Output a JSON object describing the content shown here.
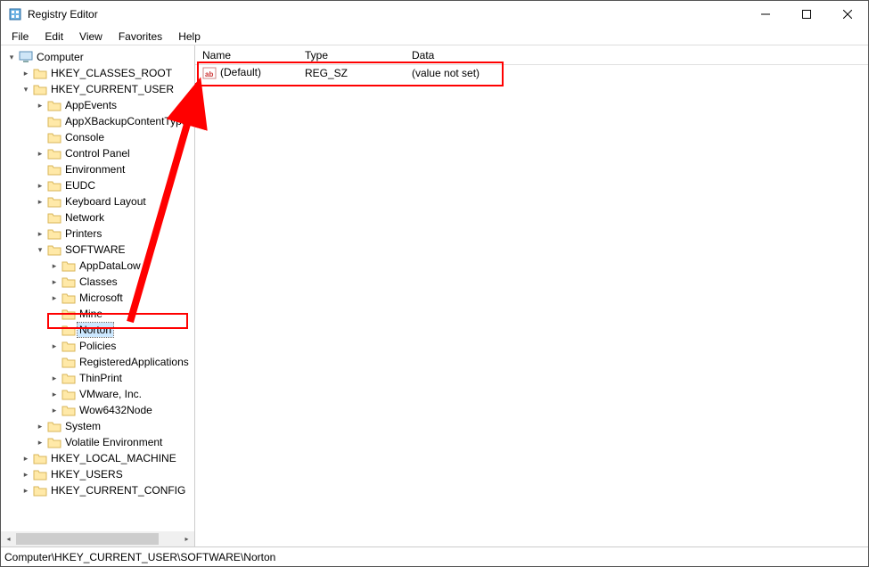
{
  "window": {
    "title": "Registry Editor"
  },
  "menu": {
    "file": "File",
    "edit": "Edit",
    "view": "View",
    "favorites": "Favorites",
    "help": "Help"
  },
  "tree": {
    "root": "Computer",
    "hkcr": "HKEY_CLASSES_ROOT",
    "hkcu": "HKEY_CURRENT_USER",
    "hkcu_children": {
      "appevents": "AppEvents",
      "appxbackup": "AppXBackupContentType",
      "console": "Console",
      "controlpanel": "Control Panel",
      "environment": "Environment",
      "eudc": "EUDC",
      "keyboard": "Keyboard Layout",
      "network": "Network",
      "printers": "Printers",
      "software": "SOFTWARE",
      "software_children": {
        "appdatalow": "AppDataLow",
        "classes": "Classes",
        "microsoft": "Microsoft",
        "mine": "Mine",
        "norton": "Norton",
        "policies": "Policies",
        "regapps": "RegisteredApplications",
        "thinprint": "ThinPrint",
        "vmware": "VMware, Inc.",
        "wow6432": "Wow6432Node"
      },
      "system": "System",
      "volatile": "Volatile Environment"
    },
    "hklm": "HKEY_LOCAL_MACHINE",
    "hku": "HKEY_USERS",
    "hkcc": "HKEY_CURRENT_CONFIG"
  },
  "grid": {
    "headers": {
      "name": "Name",
      "type": "Type",
      "data": "Data"
    },
    "rows": [
      {
        "name": "(Default)",
        "type": "REG_SZ",
        "data": "(value not set)"
      }
    ]
  },
  "statusbar": {
    "path": "Computer\\HKEY_CURRENT_USER\\SOFTWARE\\Norton"
  }
}
